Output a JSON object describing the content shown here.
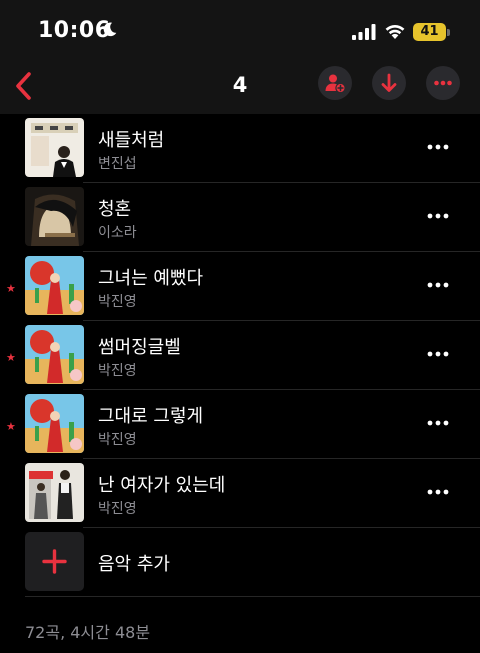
{
  "status_bar": {
    "time": "10:06",
    "battery": "41",
    "icons": [
      "moon-icon",
      "signal-icon",
      "wifi-icon",
      "battery-icon"
    ]
  },
  "nav": {
    "title": "4",
    "accent_color": "#e8323f",
    "icons": [
      "chevron-left-icon",
      "add-person-icon",
      "download-icon",
      "ellipsis-icon"
    ]
  },
  "songs": [
    {
      "title": "새들처럼",
      "artist": "변진섭",
      "favorite": false,
      "art": "art-1"
    },
    {
      "title": "청혼",
      "artist": "이소라",
      "favorite": false,
      "art": "art-2"
    },
    {
      "title": "그녀는 예뻤다",
      "artist": "박진영",
      "favorite": true,
      "art": "art-3"
    },
    {
      "title": "썸머징글벨",
      "artist": "박진영",
      "favorite": true,
      "art": "art-3"
    },
    {
      "title": "그대로 그렇게",
      "artist": "박진영",
      "favorite": true,
      "art": "art-3"
    },
    {
      "title": "난 여자가 있는데",
      "artist": "박진영",
      "favorite": false,
      "art": "art-4"
    }
  ],
  "favorite_mark": "★",
  "add_music": {
    "label": "음악 추가",
    "icon": "plus-icon"
  },
  "summary": "72곡, 4시간 48분"
}
